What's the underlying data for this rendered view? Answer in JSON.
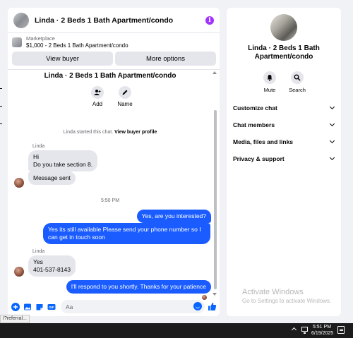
{
  "colors": {
    "accent": "#0866ff",
    "outgoing_bubble": "#1a5cff",
    "incoming_bubble": "#e4e6eb",
    "info": "#a033ff"
  },
  "chat": {
    "header_title": "Linda · 2 Beds 1 Bath Apartment/condo",
    "info_icon": "i",
    "marketplace": {
      "label": "Marketplace",
      "price_title": "$1,000 - 2 Beds 1 Bath Apartment/condo"
    },
    "buttons": {
      "view_buyer": "View buyer",
      "more_options": "More options"
    },
    "thread_title": "Linda · 2 Beds 1 Bath Apartment/condo",
    "actions": {
      "add": "Add",
      "name": "Name"
    },
    "started_text": "Linda started this chat.",
    "view_profile": "View buyer profile",
    "messages": [
      {
        "sender": "Linda",
        "lines": [
          "Hi",
          "Do you take section 8."
        ]
      },
      {
        "lines": [
          "Message sent"
        ]
      },
      {
        "time": "5:50 PM"
      },
      {
        "outgoing": "Yes, are you interested?"
      },
      {
        "outgoing": "Yes its still available Please send your phone number so I can get in touch soon"
      },
      {
        "sender": "Linda",
        "lines": [
          "Yes",
          "401-537-8143"
        ]
      },
      {
        "outgoing": "I'll respond to you shortly. Thanks for your patience"
      }
    ],
    "composer_placeholder": "Aa"
  },
  "side": {
    "title": "Linda · 2 Beds 1 Bath Apartment/condo",
    "mute": "Mute",
    "search": "Search",
    "menu": [
      "Customize chat",
      "Chat members",
      "Media, files and links",
      "Privacy & support"
    ]
  },
  "watermark": {
    "line1": "Activate Windows",
    "line2": "Go to Settings to activate Windows."
  },
  "status_url": "/?referral...",
  "taskbar": {
    "time": "5:51 PM",
    "date": "6/19/2025"
  }
}
